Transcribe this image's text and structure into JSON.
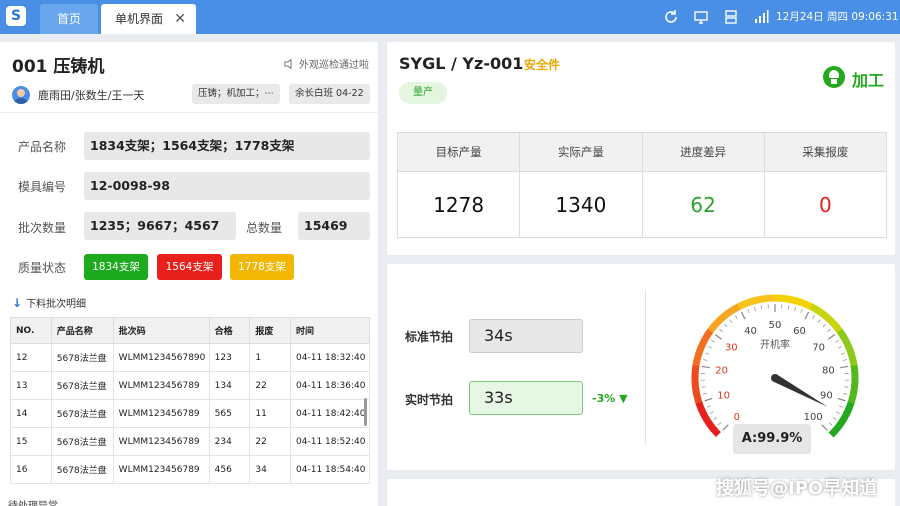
{
  "topbar": {
    "logo_letter": "S",
    "tabs": [
      {
        "label": "首页"
      },
      {
        "label": "单机界面",
        "close": "✕"
      }
    ],
    "datetime": "12月24日 周四 09:06:31",
    "icons": [
      "refresh-icon",
      "screen-icon",
      "server-icon",
      "signal-icon"
    ]
  },
  "machine": {
    "title": "001 压铸机",
    "inspection": "外观巡检通过啦",
    "operators": "鹿雨田/张数生/王一天",
    "process_chip": "压铸；机加工；⋯",
    "shift_chip": "余长白班 04-22"
  },
  "fields": {
    "product_name_label": "产品名称",
    "product_name": "1834支架；1564支架；1778支架",
    "mold_no_label": "模具编号",
    "mold_no": "12-0098-98",
    "batch_qty_label": "批次数量",
    "batch_qty": "1235；9667；4567",
    "total_label": "总数量",
    "total": "15469",
    "quality_label": "质量状态",
    "quality": [
      {
        "label": "1834支架",
        "color": "#1eaa1e"
      },
      {
        "label": "1564支架",
        "color": "#e8201c"
      },
      {
        "label": "1778支架",
        "color": "#f2b705"
      }
    ]
  },
  "batch_detail": {
    "link": "下料批次明细",
    "columns": [
      "NO.",
      "产品名称",
      "批次码",
      "合格",
      "报废",
      "时间"
    ],
    "rows": [
      [
        "12",
        "5678法兰盘",
        "WLMM1234567890",
        "123",
        "1",
        "04-11 18:32:40"
      ],
      [
        "13",
        "5678法兰盘",
        "WLMM123456789",
        "134",
        "22",
        "04-11 18:36:40"
      ],
      [
        "14",
        "5678法兰盘",
        "WLMM123456789",
        "565",
        "11",
        "04-11 18:42:40"
      ],
      [
        "15",
        "5678法兰盘",
        "WLMM123456789",
        "234",
        "22",
        "04-11 18:52:40"
      ],
      [
        "16",
        "5678法兰盘",
        "WLMM123456789",
        "456",
        "34",
        "04-11 18:54:40"
      ]
    ],
    "pending": "待处理异常"
  },
  "part": {
    "title": "SYGL / Yz-001",
    "safety": "安全件",
    "tag": "量产",
    "process": "加工"
  },
  "stats": [
    {
      "label": "目标产量",
      "value": "1278",
      "color": "#111111"
    },
    {
      "label": "实际产量",
      "value": "1340",
      "color": "#111111"
    },
    {
      "label": "进度差异",
      "value": "62",
      "color": "#2ea32e"
    },
    {
      "label": "采集报废",
      "value": "0",
      "color": "#e8201c"
    }
  ],
  "takt": {
    "std_label": "标准节拍",
    "std_value": "34s",
    "rt_label": "实时节拍",
    "rt_value": "33s",
    "delta": "-3% ▼"
  },
  "gauge": {
    "label": "开机率",
    "ticks": [
      "0",
      "10",
      "20",
      "30",
      "40",
      "50",
      "60",
      "70",
      "80",
      "90",
      "100"
    ],
    "value": 99.9,
    "readout": "A:99.9%"
  },
  "watermark": "搜狐号@IPO早知道"
}
